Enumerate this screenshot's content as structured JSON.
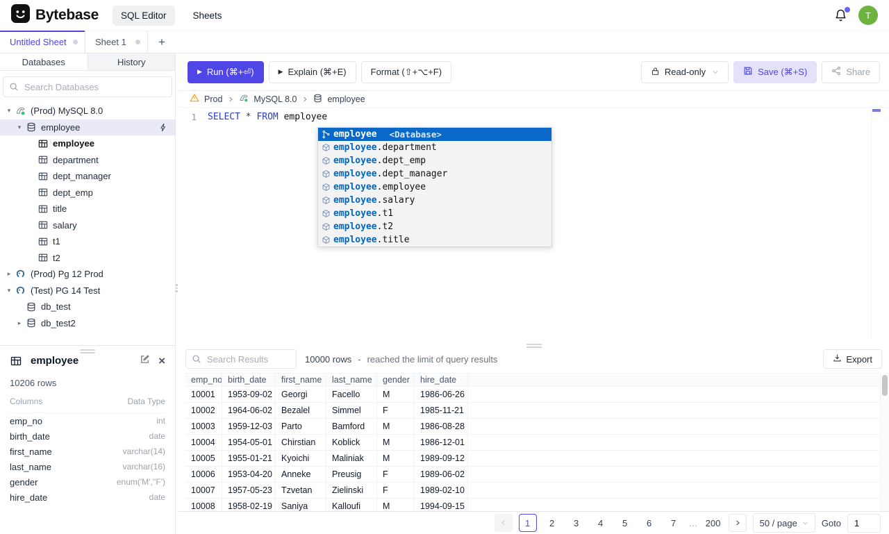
{
  "topbar": {
    "brand": "Bytebase",
    "nav_sql_editor": "SQL Editor",
    "nav_sheets": "Sheets",
    "avatar_initial": "T"
  },
  "sheet_tabs": {
    "untitled": "Untitled Sheet",
    "sheet1": "Sheet 1",
    "add": "+"
  },
  "sidebar": {
    "tab_databases": "Databases",
    "tab_history": "History",
    "search_placeholder": "Search Databases",
    "tree": [
      {
        "label": "(Prod) MySQL 8.0"
      },
      {
        "label": "employee"
      },
      {
        "label": "employee"
      },
      {
        "label": "department"
      },
      {
        "label": "dept_manager"
      },
      {
        "label": "dept_emp"
      },
      {
        "label": "title"
      },
      {
        "label": "salary"
      },
      {
        "label": "t1"
      },
      {
        "label": "t2"
      },
      {
        "label": "(Prod) Pg 12 Prod"
      },
      {
        "label": "(Test) PG 14 Test"
      },
      {
        "label": "db_test"
      },
      {
        "label": "db_test2"
      }
    ]
  },
  "schema_panel": {
    "title": "employee",
    "row_count": "10206 rows",
    "columns_header": "Columns",
    "type_header": "Data Type",
    "columns": [
      {
        "name": "emp_no",
        "type": "int"
      },
      {
        "name": "birth_date",
        "type": "date"
      },
      {
        "name": "first_name",
        "type": "varchar(14)"
      },
      {
        "name": "last_name",
        "type": "varchar(16)"
      },
      {
        "name": "gender",
        "type": "enum('M',''F')"
      },
      {
        "name": "hire_date",
        "type": "date"
      }
    ]
  },
  "toolbar": {
    "run": "Run (⌘+⏎)",
    "explain": "Explain (⌘+E)",
    "format": "Format (⇧+⌥+F)",
    "readonly": "Read-only",
    "save": "Save (⌘+S)",
    "share": "Share"
  },
  "breadcrumb": {
    "environment": "Prod",
    "instance": "MySQL 8.0",
    "database": "employee"
  },
  "editor": {
    "line_number": "1",
    "kw_select": "SELECT",
    "star": "*",
    "kw_from": "FROM",
    "table": "employee"
  },
  "suggest": {
    "selected_label": "employee",
    "selected_detail": "<Database>",
    "items": [
      {
        "match": "employee",
        "rest": ".department"
      },
      {
        "match": "employee",
        "rest": ".dept_emp"
      },
      {
        "match": "employee",
        "rest": ".dept_manager"
      },
      {
        "match": "employee",
        "rest": ".employee"
      },
      {
        "match": "employee",
        "rest": ".salary"
      },
      {
        "match": "employee",
        "rest": ".t1"
      },
      {
        "match": "employee",
        "rest": ".t2"
      },
      {
        "match": "employee",
        "rest": ".title"
      }
    ]
  },
  "results": {
    "search_placeholder": "Search Results",
    "row_count": "10000 rows",
    "separator": "-",
    "limit_note": "reached the limit of query results",
    "export": "Export",
    "headers": [
      "emp_no",
      "birth_date",
      "first_name",
      "last_name",
      "gender",
      "hire_date"
    ],
    "rows": [
      [
        "10001",
        "1953-09-02",
        "Georgi",
        "Facello",
        "M",
        "1986-06-26"
      ],
      [
        "10002",
        "1964-06-02",
        "Bezalel",
        "Simmel",
        "F",
        "1985-11-21"
      ],
      [
        "10003",
        "1959-12-03",
        "Parto",
        "Bamford",
        "M",
        "1986-08-28"
      ],
      [
        "10004",
        "1954-05-01",
        "Chirstian",
        "Koblick",
        "M",
        "1986-12-01"
      ],
      [
        "10005",
        "1955-01-21",
        "Kyoichi",
        "Maliniak",
        "M",
        "1989-09-12"
      ],
      [
        "10006",
        "1953-04-20",
        "Anneke",
        "Preusig",
        "F",
        "1989-06-02"
      ],
      [
        "10007",
        "1957-05-23",
        "Tzvetan",
        "Zielinski",
        "F",
        "1989-02-10"
      ],
      [
        "10008",
        "1958-02-19",
        "Saniya",
        "Kalloufi",
        "M",
        "1994-09-15"
      ]
    ]
  },
  "pagination": {
    "pages": [
      "1",
      "2",
      "3",
      "4",
      "5",
      "6",
      "7",
      "…",
      "200"
    ],
    "page_size": "50 / page",
    "goto_label": "Goto",
    "goto_value": "1"
  },
  "colors": {
    "accent": "#4F46E5",
    "suggest_selected": "#0A68C8",
    "avatar_green": "#6DB33F",
    "warning": "#F59E0B"
  }
}
